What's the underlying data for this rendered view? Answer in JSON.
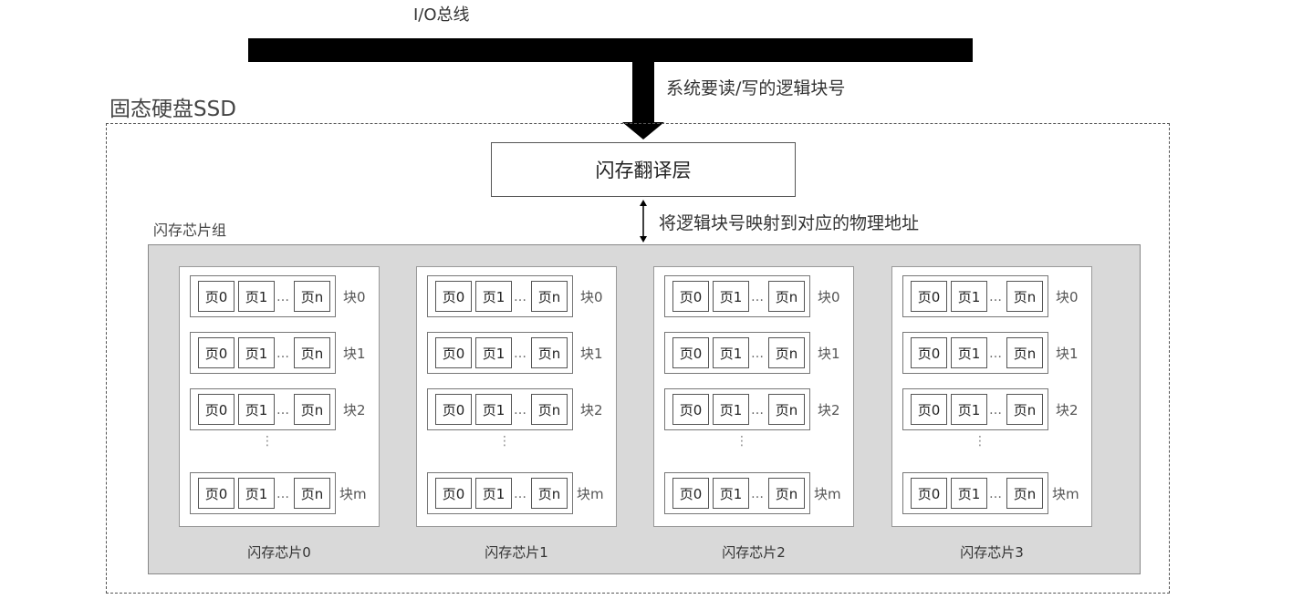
{
  "bus": {
    "label": "I/O总线"
  },
  "request": {
    "label": "系统要读/写的逻辑块号"
  },
  "ssd": {
    "title": "固态硬盘SSD"
  },
  "ftl": {
    "label": "闪存翻译层",
    "map_label": "将逻辑块号映射到对应的物理地址"
  },
  "chip_group": {
    "label": "闪存芯片组",
    "vertical_ellipsis": "⋮",
    "chips": [
      {
        "name": "闪存芯片0"
      },
      {
        "name": "闪存芯片1"
      },
      {
        "name": "闪存芯片2"
      },
      {
        "name": "闪存芯片3"
      }
    ],
    "blocks": [
      {
        "label": "块0",
        "pages": [
          "页0",
          "页1",
          "…",
          "页n"
        ]
      },
      {
        "label": "块1",
        "pages": [
          "页0",
          "页1",
          "…",
          "页n"
        ]
      },
      {
        "label": "块2",
        "pages": [
          "页0",
          "页1",
          "…",
          "页n"
        ]
      },
      {
        "label": "块m",
        "pages": [
          "页0",
          "页1",
          "…",
          "页n"
        ]
      }
    ]
  },
  "colors": {
    "bus": "#000000",
    "group_fill": "#d9d9d9",
    "border": "#555555"
  }
}
